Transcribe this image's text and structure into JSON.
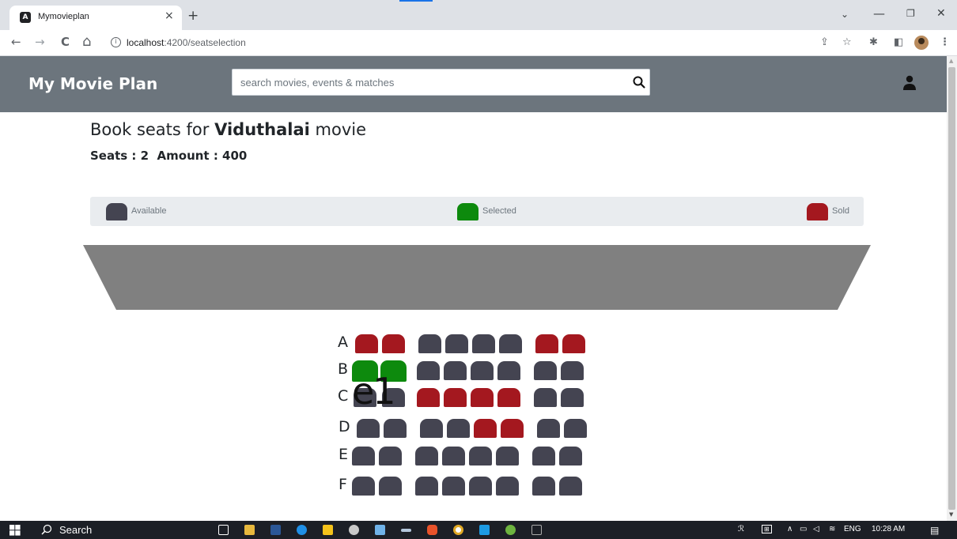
{
  "browser": {
    "tab_title": "Mymovieplan",
    "tab_close": "×",
    "new_tab": "+",
    "tab_search": "⌄",
    "minimize": "—",
    "maximize": "❐",
    "close": "✕",
    "url_host": "localhost",
    "url_rest": ":4200/seatselection",
    "back": "←",
    "forward": "→",
    "reload": "C",
    "home": "⌂"
  },
  "navbar": {
    "brand": "My Movie Plan",
    "search_placeholder": "search movies, events & matches"
  },
  "booking": {
    "title_prefix": "Book seats for ",
    "movie": "Viduthalai",
    "title_suffix": " movie",
    "seats_label": "Seats : ",
    "seats_value": "2",
    "amount_label": "Amount : ",
    "amount_value": "400"
  },
  "legend": {
    "available": "Available",
    "selected": "Selected",
    "sold": "Sold"
  },
  "colors": {
    "available": "#444451",
    "selected": "#0d8a0d",
    "sold": "#a4181f",
    "navbar": "#6c757d",
    "screen": "#808080"
  },
  "rows": [
    {
      "label": "A",
      "seats": [
        "sold",
        "sold",
        "available",
        "available",
        "available",
        "available",
        "sold",
        "sold"
      ]
    },
    {
      "label": "B",
      "seats": [
        "selected",
        "selected",
        "available",
        "available",
        "available",
        "available",
        "available",
        "available"
      ]
    },
    {
      "label": "C",
      "seats": [
        "available",
        "available",
        "sold",
        "sold",
        "sold",
        "sold",
        "available",
        "available"
      ]
    },
    {
      "label": "D",
      "seats": [
        "available",
        "available",
        "available",
        "available",
        "sold",
        "sold",
        "available",
        "available"
      ]
    },
    {
      "label": "E",
      "seats": [
        "available",
        "available",
        "available",
        "available",
        "available",
        "available",
        "available",
        "available"
      ]
    },
    {
      "label": "F",
      "seats": [
        "available",
        "available",
        "available",
        "available",
        "available",
        "available",
        "available",
        "available"
      ]
    }
  ],
  "overlay_text": "e1",
  "taskbar": {
    "search_label": "Search",
    "language": "ENG",
    "time": "10:28 AM"
  }
}
